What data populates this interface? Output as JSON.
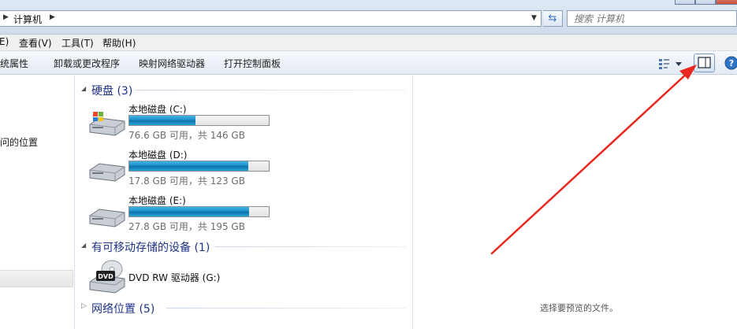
{
  "address_bar": {
    "breadcrumb": "计算机",
    "search_placeholder": "搜索 计算机"
  },
  "menu": {
    "items": [
      "E)",
      "查看(V)",
      "工具(T)",
      "帮助(H)"
    ]
  },
  "command_bar": {
    "items": [
      "系统属性",
      "卸载或更改程序",
      "映射网络驱动器",
      "打开控制面板"
    ]
  },
  "nav": {
    "location_label": "问的位置"
  },
  "groups": {
    "hard_disks": {
      "title": "硬盘 (3)"
    },
    "removable": {
      "title": "有可移动存储的设备 (1)"
    },
    "network": {
      "title": "网络位置 (5)"
    }
  },
  "drives": [
    {
      "name": "本地磁盘 (C:)",
      "space": "76.6 GB 可用，共 146 GB",
      "used_fraction": 0.475,
      "system": true
    },
    {
      "name": "本地磁盘 (D:)",
      "space": "17.8 GB 可用，共 123 GB",
      "used_fraction": 0.855,
      "system": false
    },
    {
      "name": "本地磁盘 (E:)",
      "space": "27.8 GB 可用，共 195 GB",
      "used_fraction": 0.857,
      "system": false
    }
  ],
  "dvd": {
    "name": "DVD RW 驱动器 (G:)",
    "badge": "DVD"
  },
  "preview": {
    "message": "选择要预览的文件。"
  },
  "colors": {
    "group_title": "#1e3287",
    "drive_bar_fill": "#1d8fc9",
    "annotation_arrow": "#e8281e"
  },
  "icons": {
    "preview_pane": "preview-pane-icon",
    "help": "help-icon",
    "views": "views-icon",
    "refresh": "refresh-icon"
  }
}
